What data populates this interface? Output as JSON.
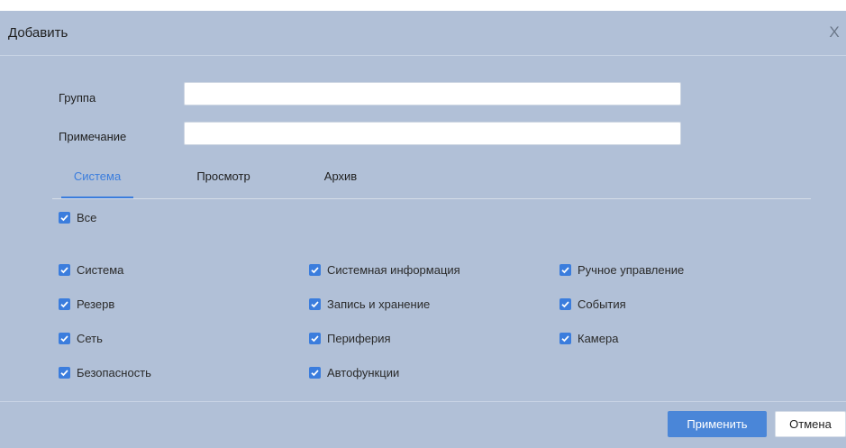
{
  "dialog": {
    "title": "Добавить",
    "close_label": "X"
  },
  "form": {
    "group_label": "Группа",
    "group_value": "",
    "note_label": "Примечание",
    "note_value": ""
  },
  "tabs": [
    {
      "label": "Система",
      "active": true
    },
    {
      "label": "Просмотр",
      "active": false
    },
    {
      "label": "Архив",
      "active": false
    }
  ],
  "all_checkbox": {
    "label": "Все",
    "checked": true
  },
  "permissions": [
    {
      "label": "Система",
      "checked": true
    },
    {
      "label": "Резерв",
      "checked": true
    },
    {
      "label": "Сеть",
      "checked": true
    },
    {
      "label": "Безопасность",
      "checked": true
    },
    {
      "label": "Системная информация",
      "checked": true
    },
    {
      "label": "Запись и хранение",
      "checked": true
    },
    {
      "label": "Периферия",
      "checked": true
    },
    {
      "label": "Автофункции",
      "checked": true
    },
    {
      "label": "Ручное управление",
      "checked": true
    },
    {
      "label": "События",
      "checked": true
    },
    {
      "label": "Камера",
      "checked": true
    }
  ],
  "buttons": {
    "apply": "Применить",
    "cancel": "Отмена"
  },
  "colors": {
    "dialog_bg": "#b1c0d7",
    "accent": "#3b7ddd",
    "apply_bg": "#4a86d8"
  },
  "icons": {
    "close": "close-icon",
    "check": "checkmark-icon"
  }
}
